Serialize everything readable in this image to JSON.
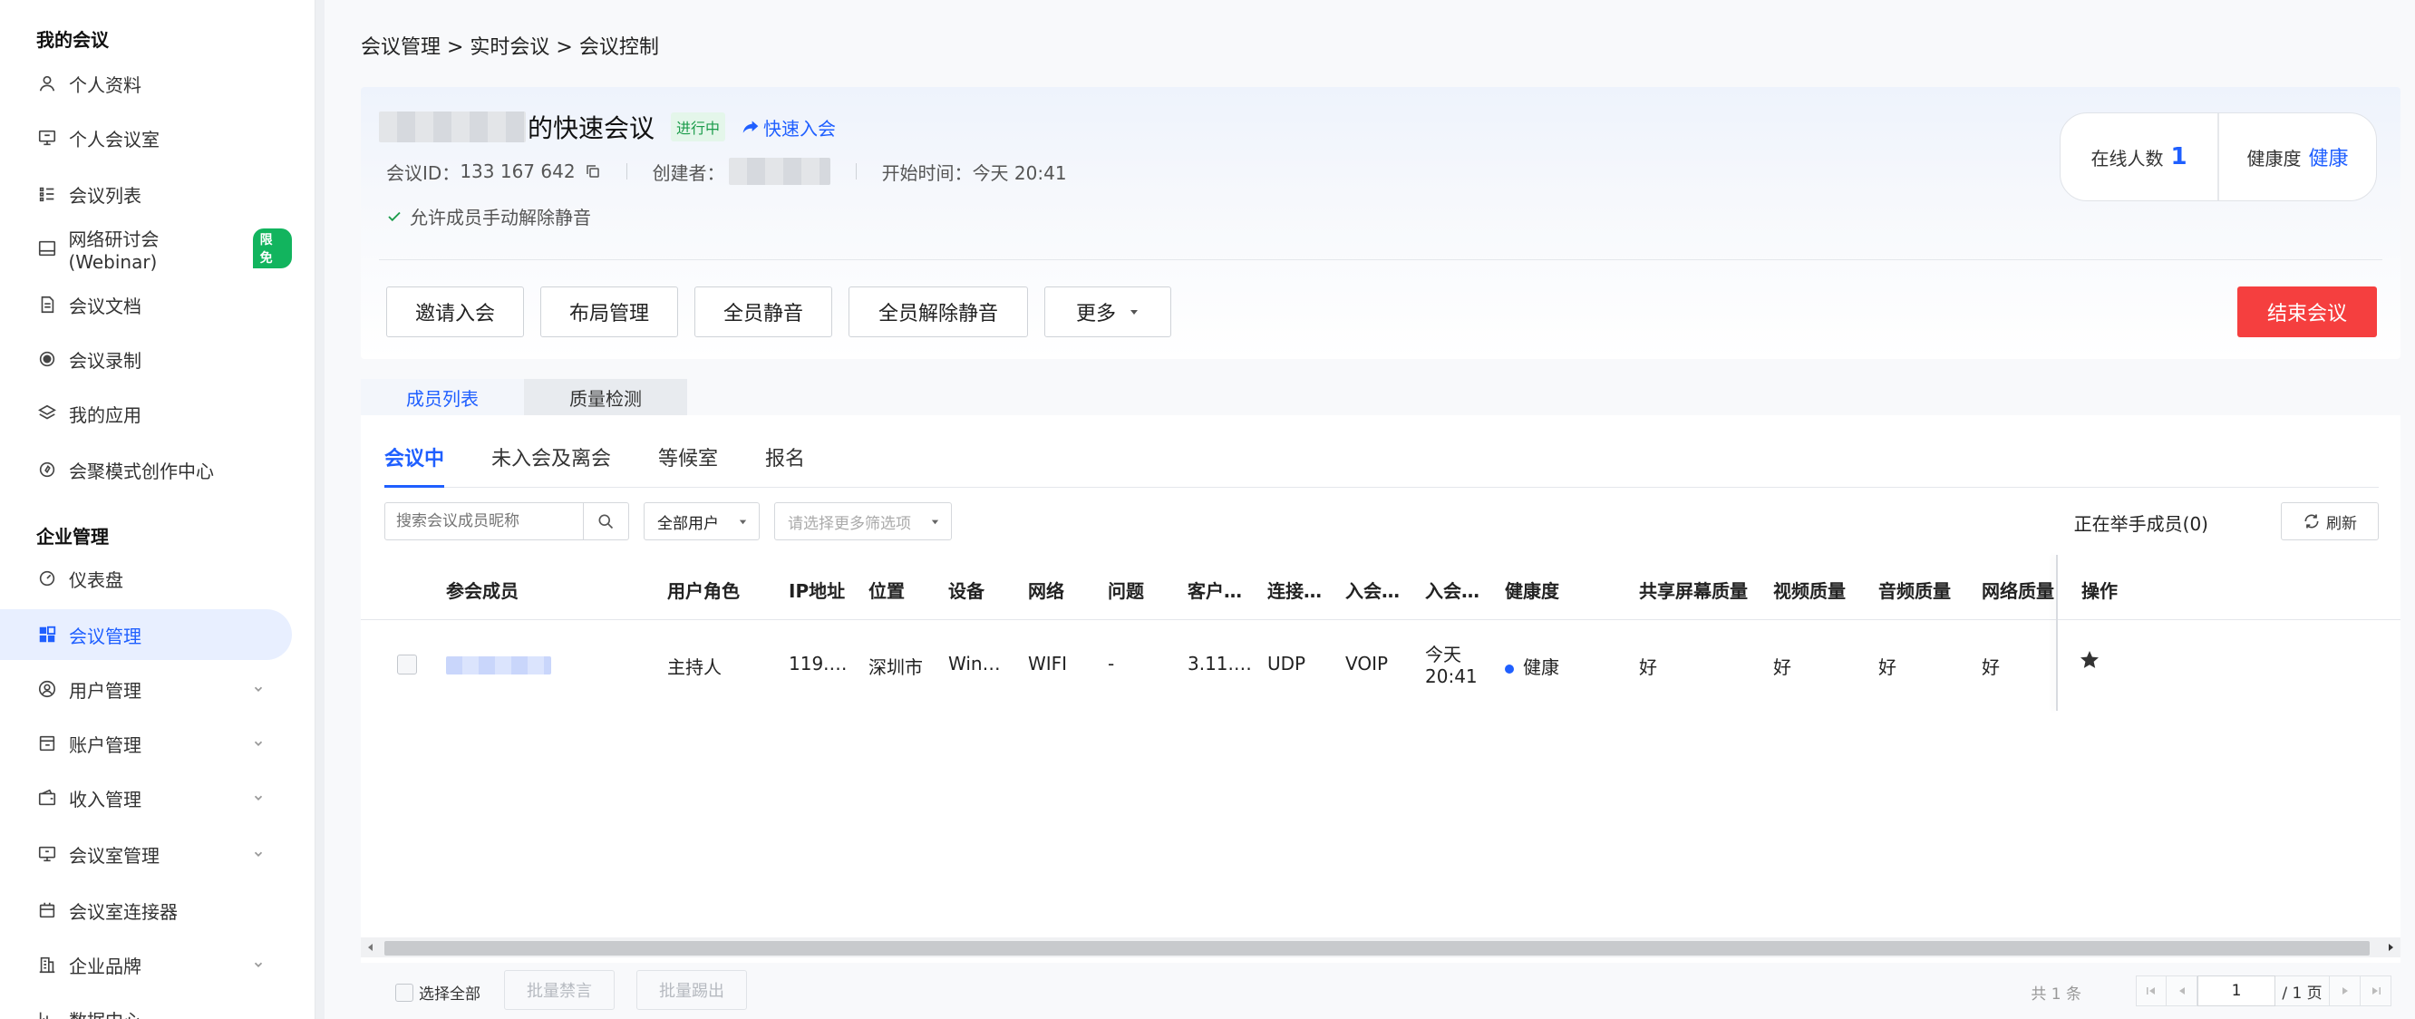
{
  "sidebar": {
    "section_my": "我的会议",
    "section_enterprise": "企业管理",
    "items": [
      {
        "label": "个人资料"
      },
      {
        "label": "个人会议室"
      },
      {
        "label": "会议列表"
      },
      {
        "label": "网络研讨会(Webinar)",
        "badge": "限免"
      },
      {
        "label": "会议文档"
      },
      {
        "label": "会议录制"
      },
      {
        "label": "我的应用"
      },
      {
        "label": "会聚模式创作中心"
      },
      {
        "label": "仪表盘"
      },
      {
        "label": "会议管理",
        "active": true
      },
      {
        "label": "用户管理"
      },
      {
        "label": "账户管理"
      },
      {
        "label": "收入管理"
      },
      {
        "label": "会议室管理"
      },
      {
        "label": "会议室连接器"
      },
      {
        "label": "企业品牌"
      },
      {
        "label": "数据中心"
      }
    ]
  },
  "breadcrumb": "会议管理 > 实时会议 > 会议控制",
  "meeting": {
    "title_suffix": "的快速会议",
    "status": "进行中",
    "quick_join": "快速入会",
    "id_label": "会议ID：",
    "id_value": "133 167 642",
    "creator_label": "创建者：",
    "start_label": "开始时间：",
    "start_value": "今天 20:41",
    "permission": "允许成员手动解除静音"
  },
  "stats": {
    "online_label": "在线人数",
    "online_value": "1",
    "health_label": "健康度",
    "health_value": "健康"
  },
  "actions": {
    "invite": "邀请入会",
    "layout": "布局管理",
    "mute_all": "全员静音",
    "unmute_all": "全员解除静音",
    "more": "更多",
    "end": "结束会议"
  },
  "section_tabs": [
    "成员列表",
    "质量检测"
  ],
  "sub_tabs": [
    "会议中",
    "未入会及离会",
    "等候室",
    "报名"
  ],
  "filters": {
    "search_placeholder": "搜索会议成员昵称",
    "user_type": "全部用户",
    "more_placeholder": "请选择更多筛选项",
    "raise_hand": "正在举手成员(0)",
    "refresh": "刷新"
  },
  "table": {
    "headers": [
      "参会成员",
      "用户角色",
      "IP地址",
      "位置",
      "设备",
      "网络",
      "问题",
      "客户…",
      "连接…",
      "入会…",
      "入会…",
      "健康度",
      "共享屏幕质量",
      "视频质量",
      "音频质量",
      "网络质量",
      "操作"
    ],
    "rows": [
      {
        "role": "主持人",
        "ip": "119.…",
        "location": "深圳市",
        "device": "Win…",
        "network": "WIFI",
        "issue": "-",
        "client": "3.11.…",
        "connection": "UDP",
        "join_type": "VOIP",
        "join_time_1": "今天",
        "join_time_2": "20:41",
        "health": "健康",
        "share_quality": "好",
        "video_quality": "好",
        "audio_quality": "好",
        "network_quality": "好"
      }
    ]
  },
  "footer": {
    "select_all": "选择全部",
    "batch_mute": "批量禁言",
    "batch_remove": "批量踢出",
    "total": "共 1 条",
    "page": "1",
    "page_total": "/ 1 页"
  }
}
